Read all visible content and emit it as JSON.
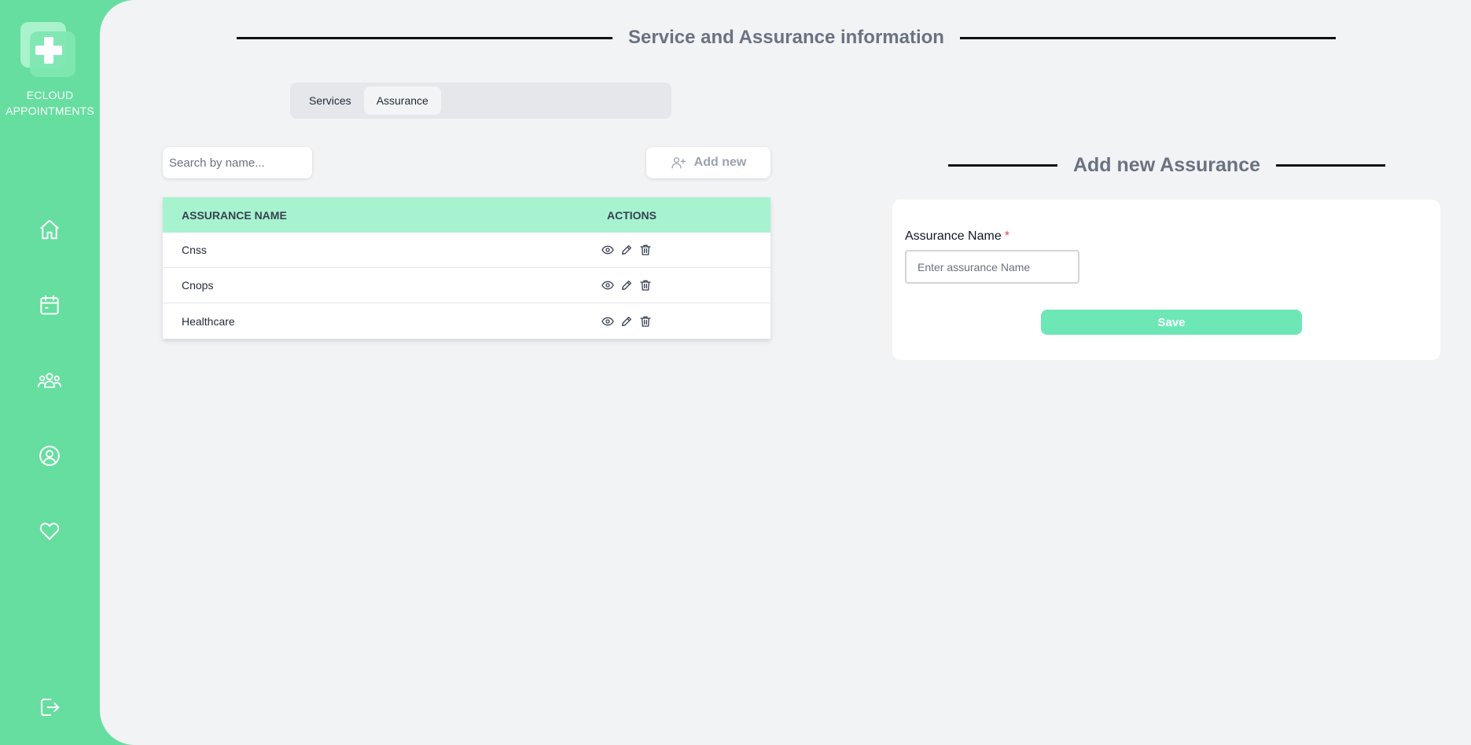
{
  "app": {
    "brand_line1": "ECLOUD",
    "brand_line2": "APPOINTMENTS"
  },
  "sidebar": {
    "icons": [
      "home-icon",
      "calendar-icon",
      "users-icon",
      "user-circle-icon",
      "heart-icon",
      "logout-icon"
    ]
  },
  "header": {
    "title": "Service and Assurance information"
  },
  "tabs": [
    {
      "label": "Services",
      "active": false
    },
    {
      "label": "Assurance",
      "active": true
    }
  ],
  "search": {
    "placeholder": "Search by name..."
  },
  "add_new": {
    "label": "Add new",
    "icon": "user-plus-icon"
  },
  "table": {
    "columns": [
      "ASSURANCE NAME",
      "ACTIONS"
    ],
    "rows": [
      {
        "name": "Cnss"
      },
      {
        "name": "Cnops"
      },
      {
        "name": "Healthcare"
      }
    ],
    "row_actions": [
      "eye-icon",
      "pencil-icon",
      "trash-icon"
    ]
  },
  "form": {
    "title": "Add new Assurance",
    "field_label": "Assurance Name",
    "required_mark": "*",
    "field_placeholder": "Enter assurance Name",
    "field_value": "",
    "save_label": "Save"
  },
  "colors": {
    "sidebar": "#66de9f",
    "table_header": "#a7f3d0",
    "save_button": "#6ee7b7",
    "required": "#ef4444"
  }
}
